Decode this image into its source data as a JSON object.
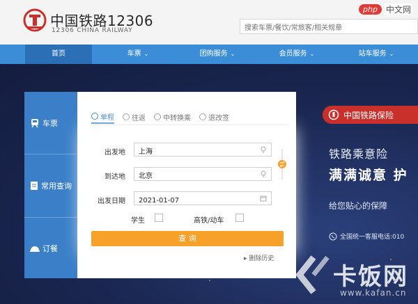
{
  "header": {
    "logo_cn": "中国铁路12306",
    "logo_en": "12306 CHINA RAILWAY",
    "search_placeholder": "搜索车票/餐饮/常旅客/相关规章"
  },
  "watermark_top": {
    "badge": "php",
    "text": "中文网"
  },
  "nav": {
    "items": [
      {
        "label": "首页",
        "chevron": ""
      },
      {
        "label": "车票",
        "chevron": "⌄"
      },
      {
        "label": "团购服务",
        "chevron": "⌄"
      },
      {
        "label": "会员服务",
        "chevron": "⌄"
      },
      {
        "label": "站车服务",
        "chevron": "⌄"
      }
    ]
  },
  "left_tabs": [
    {
      "label": "车票",
      "icon": "train-icon"
    },
    {
      "label": "常用查询",
      "icon": "document-icon"
    },
    {
      "label": "订餐",
      "icon": "meal-icon"
    }
  ],
  "form": {
    "subtabs": [
      "单程",
      "往返",
      "中转换乘",
      "退改签"
    ],
    "from_label": "出发地",
    "from_value": "上海",
    "to_label": "到达地",
    "to_value": "北京",
    "date_label": "出发日期",
    "date_value": "2021-01-07",
    "student_label": "学生",
    "highspeed_label": "高铁/动车",
    "search_button": "查 询",
    "history_link": "删除历史"
  },
  "promo": {
    "badge": "中国铁路保险",
    "title": "铁路乘意险",
    "main": "满满诚意 护",
    "sub": "给您贴心的保障",
    "hotline": "全国统一客服电话:010"
  },
  "watermark_bottom": {
    "text": "卡饭网",
    "url": "www.kafan.cn"
  },
  "colors": {
    "nav_blue": "#3b8dd8",
    "active_blue": "#2b6fb6",
    "orange": "#f7a12b",
    "red": "#c9302c"
  }
}
